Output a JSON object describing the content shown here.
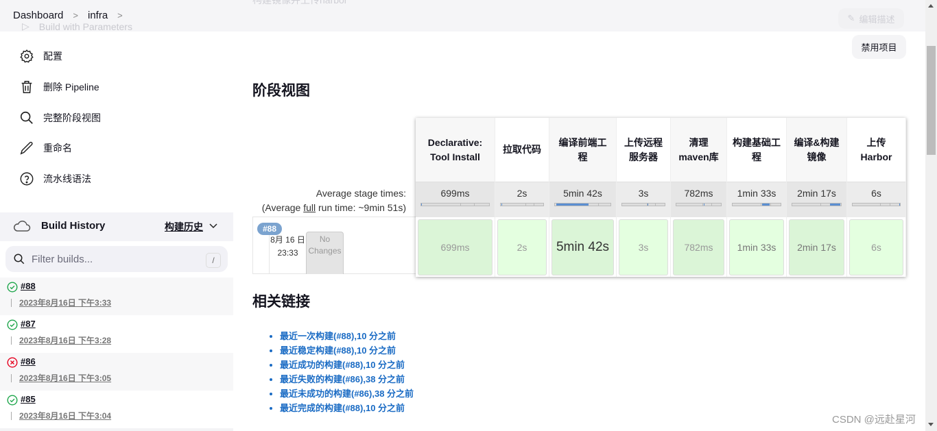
{
  "breadcrumb": [
    {
      "label": "Dashboard"
    },
    {
      "label": "infra"
    }
  ],
  "ghost": {
    "build_with_params": "Build with Parameters",
    "description": "构建镜像并上传harbor",
    "edit_description": "编辑描述"
  },
  "sidebar": {
    "items": [
      {
        "label": "配置",
        "icon": "gear-icon"
      },
      {
        "label": "删除 Pipeline",
        "icon": "trash-icon"
      },
      {
        "label": "完整阶段视图",
        "icon": "search-icon"
      },
      {
        "label": "重命名",
        "icon": "pencil-icon"
      },
      {
        "label": "流水线语法",
        "icon": "help-icon"
      }
    ]
  },
  "build_history": {
    "title": "Build History",
    "link": "构建历史",
    "filter_placeholder": "Filter builds...",
    "filter_shortcut": "/",
    "builds": [
      {
        "number": "#88",
        "date": "2023年8月16日 下午3:33",
        "status": "success"
      },
      {
        "number": "#87",
        "date": "2023年8月16日 下午3:28",
        "status": "success"
      },
      {
        "number": "#86",
        "date": "2023年8月16日 下午3:05",
        "status": "failed"
      },
      {
        "number": "#85",
        "date": "2023年8月16日 下午3:04",
        "status": "success"
      }
    ]
  },
  "main": {
    "disable_button": "禁用项目",
    "stage_view_title": "阶段视图",
    "avg_line1": "Average stage times:",
    "avg_line2_pre": "(Average ",
    "avg_line2_link": "full",
    "avg_line2_post": " run time: ~9min 51s)",
    "run": {
      "badge": "#88",
      "date": "8月 16 日",
      "time": "23:33",
      "changes": "No Changes"
    },
    "stages": [
      {
        "name": "Declarative: Tool Install",
        "avg": "699ms",
        "run": "699ms",
        "bar_start": 0,
        "bar_end": 0.01,
        "size": "small"
      },
      {
        "name": "拉取代码",
        "avg": "2s",
        "run": "2s",
        "bar_start": 0.01,
        "bar_end": 0.02,
        "size": "small"
      },
      {
        "name": "编译前端工程",
        "avg": "5min 42s",
        "run": "5min 42s",
        "bar_start": 0.02,
        "bar_end": 0.6,
        "size": "long"
      },
      {
        "name": "上传远程服务器",
        "avg": "3s",
        "run": "3s",
        "bar_start": 0.6,
        "bar_end": 0.61,
        "size": "small"
      },
      {
        "name": "清理maven库",
        "avg": "782ms",
        "run": "782ms",
        "bar_start": 0.61,
        "bar_end": 0.62,
        "size": "small"
      },
      {
        "name": "构建基础工程",
        "avg": "1min 33s",
        "run": "1min 33s",
        "bar_start": 0.62,
        "bar_end": 0.77,
        "size": "med"
      },
      {
        "name": "编译&构建镜像",
        "avg": "2min 17s",
        "run": "2min 17s",
        "bar_start": 0.77,
        "bar_end": 0.99,
        "size": "med"
      },
      {
        "name": "上传Harbor",
        "avg": "6s",
        "run": "6s",
        "bar_start": 0.99,
        "bar_end": 1.0,
        "size": "small"
      }
    ],
    "links_title": "相关链接",
    "links": [
      "最近一次构建(#88),10 分之前",
      "最近稳定构建(#88),10 分之前",
      "最近成功的构建(#88),10 分之前",
      "最近失败的构建(#86),38 分之前",
      "最近未成功的构建(#86),38 分之前",
      "最近完成的构建(#88),10 分之前"
    ]
  },
  "watermark": "CSDN @远赴星河",
  "colors": {
    "success": "#1ea64b",
    "failed": "#e6001f",
    "link": "#1a6bc4",
    "badge": "#7ba3cf",
    "stage_success": "#e4ffe0"
  }
}
